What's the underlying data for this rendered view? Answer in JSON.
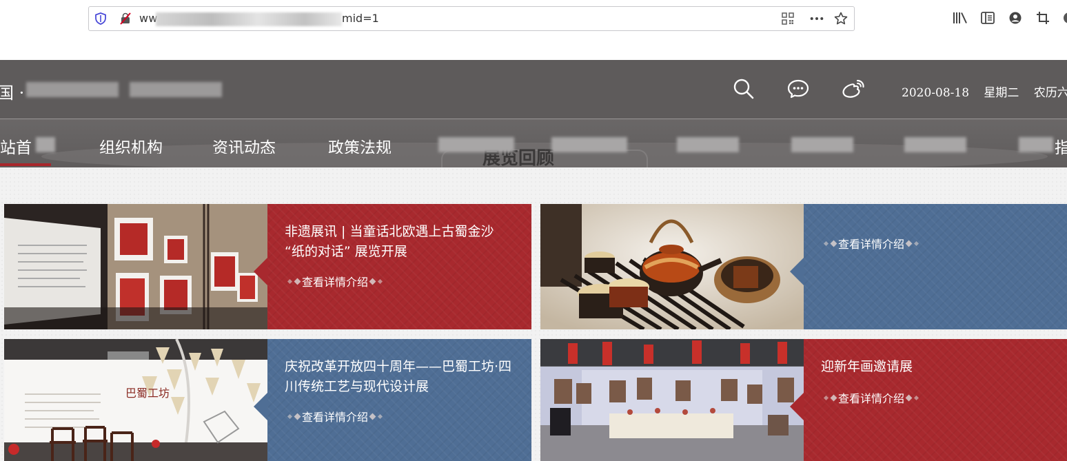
{
  "browser": {
    "url_prefix": "ww",
    "url_suffix": "mid=1",
    "icons": [
      "shield-icon",
      "insecure-lock-icon",
      "qr-code-icon",
      "more-icon",
      "bookmark-star-icon",
      "library-icon",
      "reader-view-icon",
      "account-icon",
      "crop-icon"
    ]
  },
  "header": {
    "site_title_prefix": "国 ·",
    "date": "2020-08-18",
    "weekday": "星期二",
    "lunar": "农历六",
    "icons": [
      "search-icon",
      "wechat-icon",
      "weibo-icon"
    ]
  },
  "nav": {
    "items": [
      "站首",
      "组织机构",
      "资讯动态",
      "政策法规",
      "",
      "",
      "",
      "",
      "指"
    ],
    "active_index": 0,
    "section_peek": "展览回顾"
  },
  "cards": [
    {
      "title": "非遗展讯 | 当童话北欧遇上古蜀金沙 “纸的对话” 展览开展",
      "more": "查看详情介绍",
      "theme": "red"
    },
    {
      "title": "",
      "more": "查看详情介绍",
      "theme": "blue"
    },
    {
      "title": "庆祝改革开放四十周年——巴蜀工坊·四川传统工艺与现代设计展",
      "more": "查看详情介绍",
      "theme": "blue"
    },
    {
      "title": "迎新年画邀请展",
      "more": "查看详情介绍",
      "theme": "red"
    }
  ],
  "colors": {
    "red": "#a8292e",
    "blue": "#4f6e95",
    "header_bg": "#5e5b5b"
  }
}
